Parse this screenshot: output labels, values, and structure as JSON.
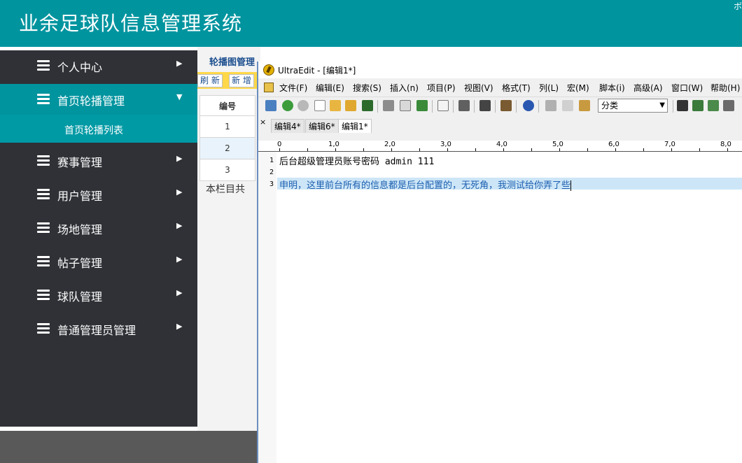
{
  "header": {
    "title": "业余足球队信息管理系统",
    "corner_text": "ボ"
  },
  "sidebar": {
    "items": [
      {
        "label": "个人中心",
        "arrow": "▶",
        "active": false
      },
      {
        "label": "首页轮播管理",
        "arrow": "▼",
        "active": true,
        "sub": [
          "首页轮播列表"
        ]
      },
      {
        "label": "赛事管理",
        "arrow": "▶",
        "active": false
      },
      {
        "label": "用户管理",
        "arrow": "▶",
        "active": false
      },
      {
        "label": "场地管理",
        "arrow": "▶",
        "active": false
      },
      {
        "label": "帖子管理",
        "arrow": "▶",
        "active": false
      },
      {
        "label": "球队管理",
        "arrow": "▶",
        "active": false
      },
      {
        "label": "普通管理员管理",
        "arrow": "▶",
        "active": false
      }
    ]
  },
  "content": {
    "title": "轮播图管理",
    "buttons": [
      "刷 新",
      "新 增"
    ],
    "table": {
      "header": "编号",
      "rows": [
        "1",
        "2",
        "3"
      ]
    },
    "total_text": "本栏目共"
  },
  "ultraedit": {
    "title": "UltraEdit - [编辑1*]",
    "menu": [
      "文件(F)",
      "编辑(E)",
      "搜索(S)",
      "插入(n)",
      "项目(P)",
      "视图(V)",
      "格式(T)",
      "列(L)",
      "宏(M)",
      "脚本(i)",
      "高级(A)",
      "窗口(W)",
      "帮助(H)"
    ],
    "combo_value": "分类",
    "tab_close": "×",
    "tabs": [
      "编辑4*",
      "编辑6*",
      "编辑1*"
    ],
    "active_tab": 2,
    "ruler": [
      "0",
      "1,0",
      "2,0",
      "3,0",
      "4,0",
      "5,0",
      "6,0",
      "7,0",
      "8,0"
    ],
    "lines": [
      {
        "num": "1",
        "text": "后台超级管理员账号密码 admin 111"
      },
      {
        "num": "2",
        "text": ""
      },
      {
        "num": "3",
        "text": "申明，这里前台所有的信息都是后台配置的，无死角，我测试给你弄了些"
      }
    ]
  },
  "colors": {
    "teal": "#00949f",
    "sidebar_bg": "#2f3136",
    "selection": "#cde6f7"
  }
}
